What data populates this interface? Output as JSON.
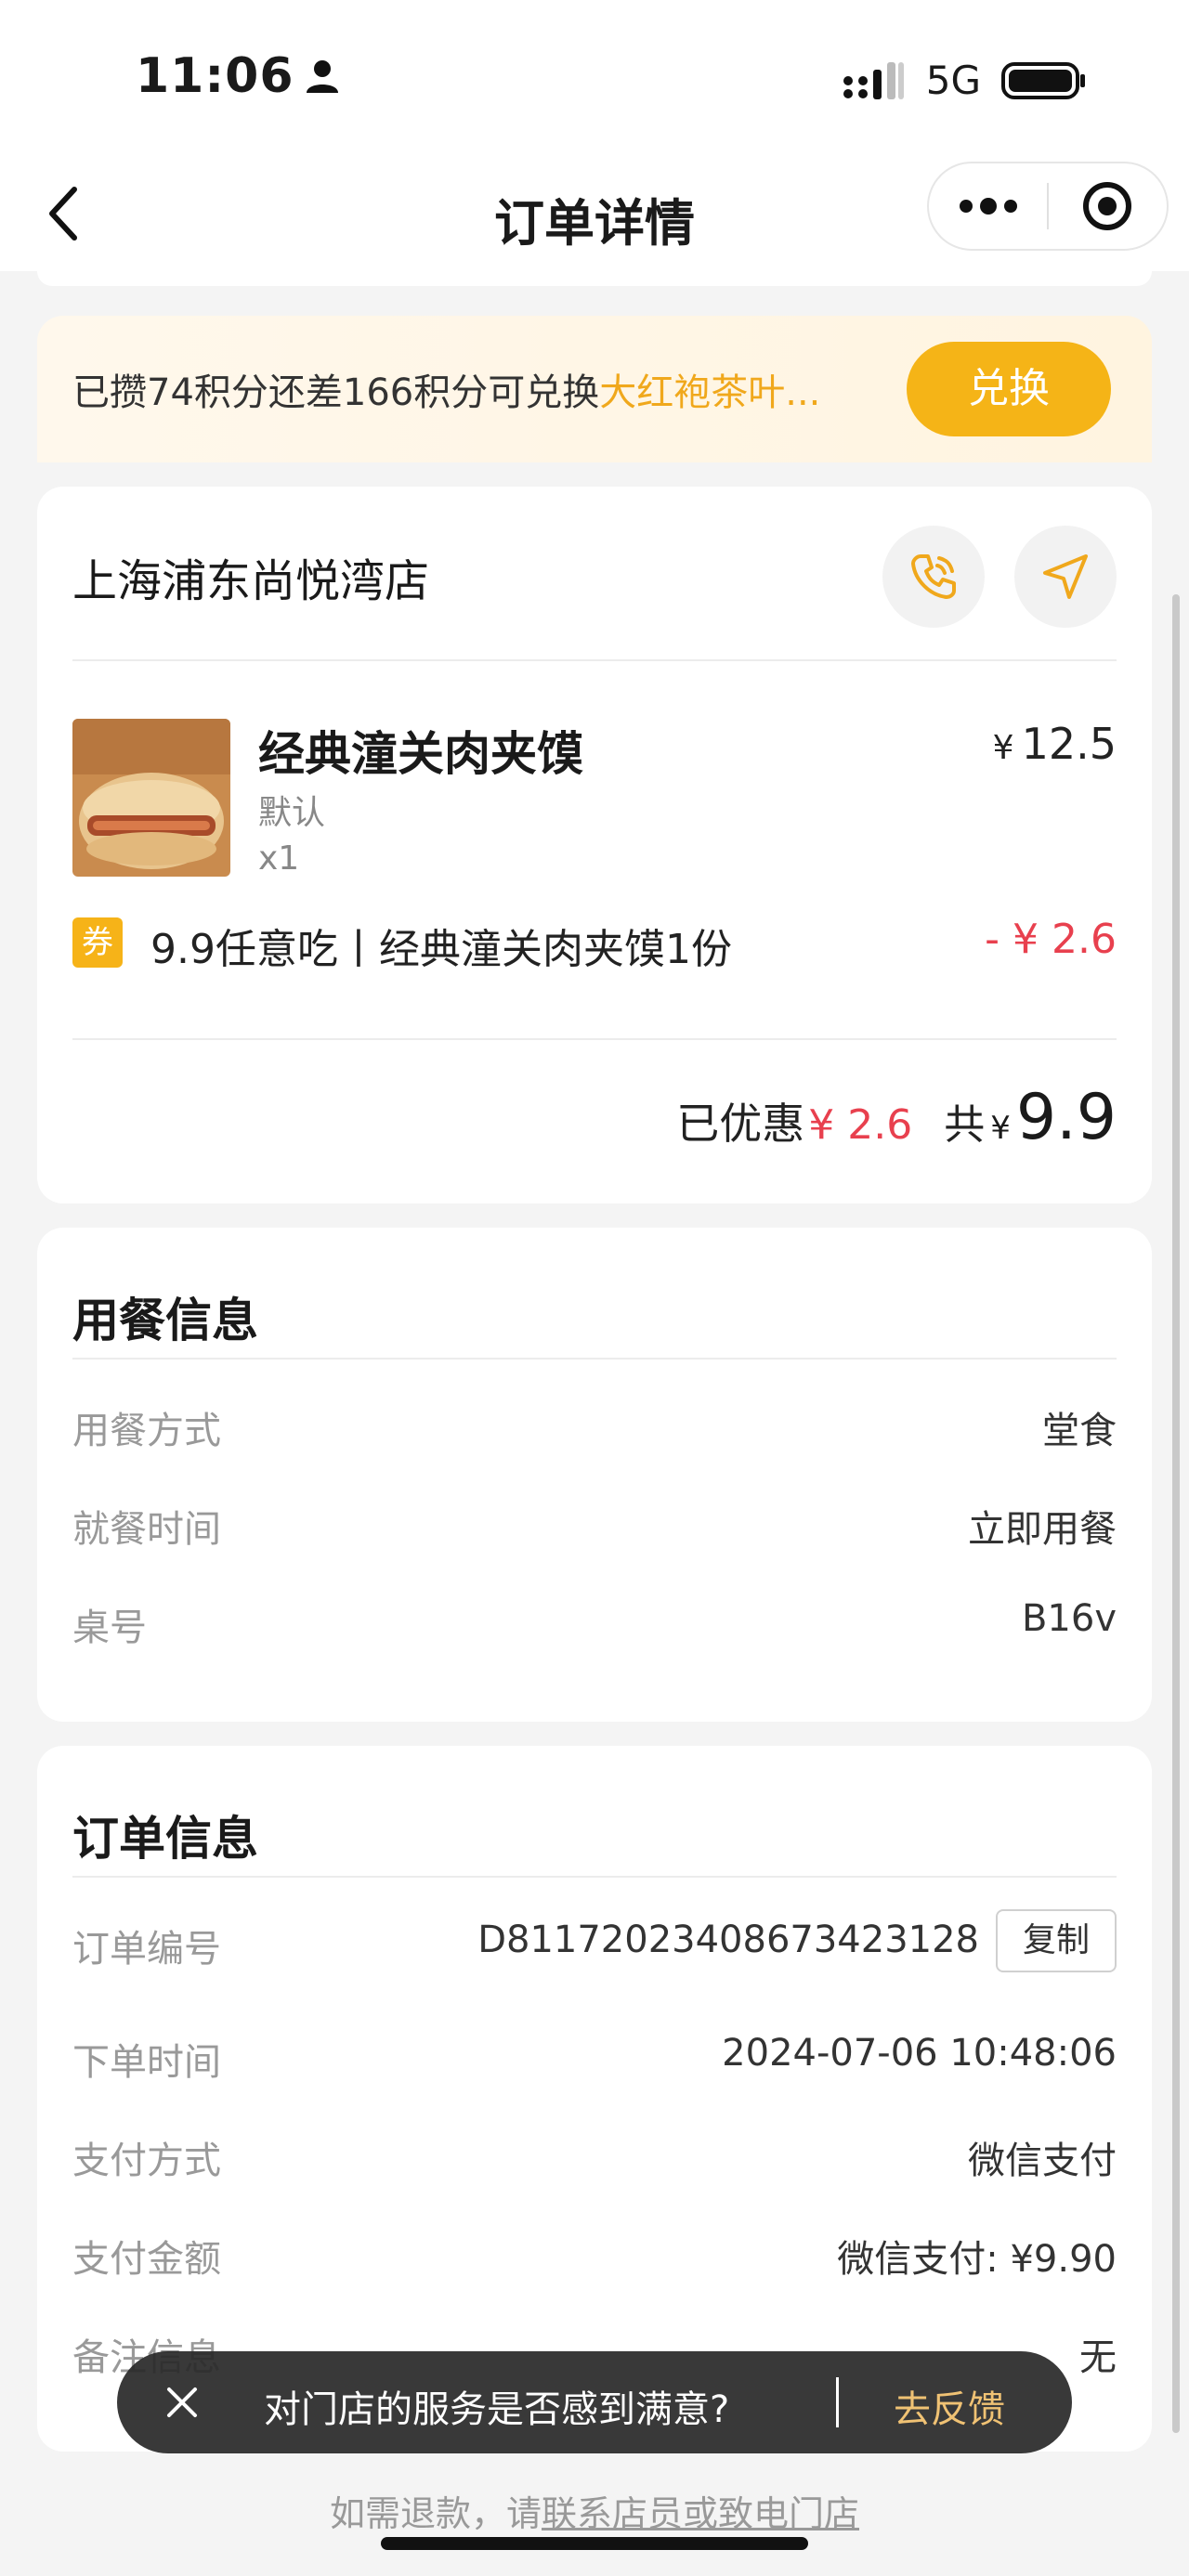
{
  "status_bar": {
    "time": "11:06",
    "network": "5G"
  },
  "nav": {
    "title": "订单详情"
  },
  "points": {
    "prefix": "已攒74积分还差166积分可兑换",
    "reward": "大红袍茶叶...",
    "redeem_label": "兑换"
  },
  "store": {
    "name": "上海浦东尚悦湾店",
    "item": {
      "name": "经典潼关肉夹馍",
      "spec": "默认",
      "qty": "x1",
      "currency": "¥",
      "price": "12.5"
    },
    "coupon": {
      "tag": "券",
      "name": "9.9任意吃丨经典潼关肉夹馍1份",
      "amount": "- ¥ 2.6"
    },
    "summary": {
      "discount_label": "已优惠",
      "discount_value": "¥ 2.6",
      "total_label": "共",
      "total_currency": "¥",
      "total_value": "9.9"
    }
  },
  "dining": {
    "title": "用餐信息",
    "rows": [
      {
        "key": "用餐方式",
        "value": "堂食"
      },
      {
        "key": "就餐时间",
        "value": "立即用餐"
      },
      {
        "key": "桌号",
        "value": "B16v"
      }
    ]
  },
  "order": {
    "title": "订单信息",
    "order_no_label": "订单编号",
    "order_no": "D81172023408673423128",
    "copy_label": "复制",
    "rows": [
      {
        "key": "下单时间",
        "value": "2024-07-06 10:48:06"
      },
      {
        "key": "支付方式",
        "value": "微信支付"
      },
      {
        "key": "支付金额",
        "value": "微信支付: ¥9.90"
      },
      {
        "key": "备注信息",
        "value": "无"
      }
    ]
  },
  "feedback": {
    "question": "对门店的服务是否感到满意?",
    "action": "去反馈"
  },
  "refund": {
    "prefix": "如需退款，请",
    "link": "联系店员或致电门店"
  },
  "colors": {
    "accent": "#f5b417",
    "discount_red": "#e8404e",
    "points_highlight": "#f0a81c",
    "feedback_link": "#f0c274"
  }
}
